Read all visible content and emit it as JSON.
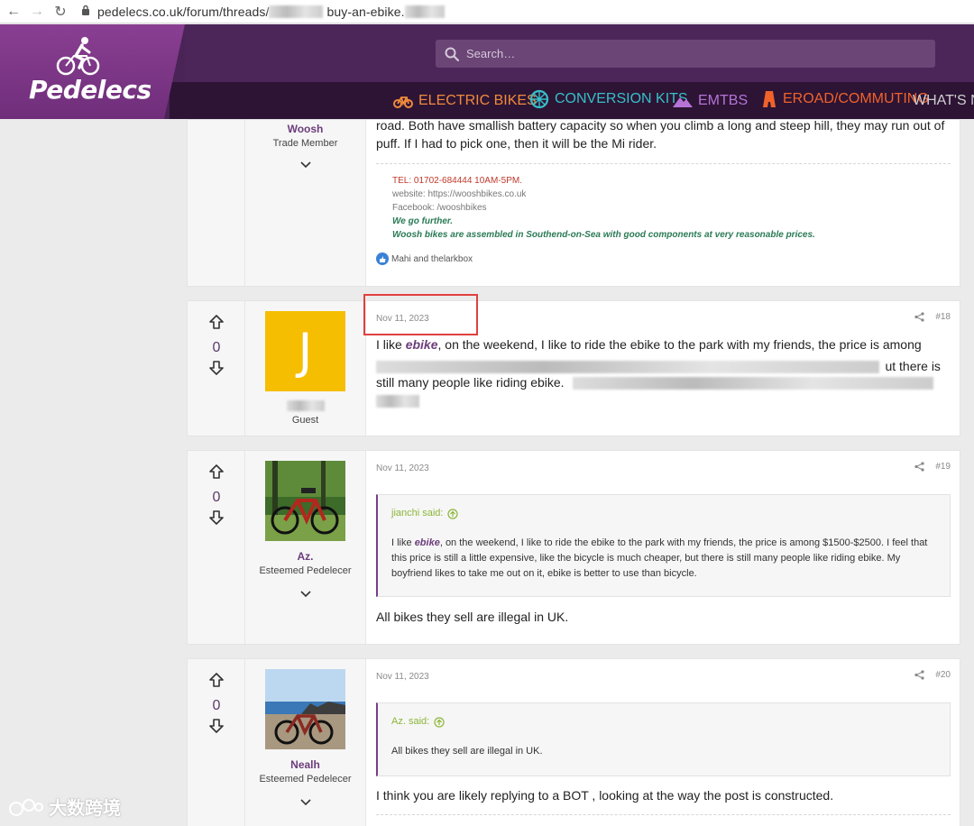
{
  "browser": {
    "url_prefix": "pedelecs.co.uk/forum/threads/",
    "url_suffix": "buy-an-ebike."
  },
  "header": {
    "logo_text": "Pedelecs",
    "search_placeholder": "Search…",
    "nav": [
      {
        "label": "ELECTRIC BIKES",
        "color": "#f08a3c"
      },
      {
        "label": "CONVERSION KITS",
        "color": "#36c0c7"
      },
      {
        "label": "EMTBS",
        "color": "#b674d6"
      },
      {
        "label": "EROAD/COMMUTING",
        "color": "#f0622a"
      },
      {
        "label": "WHAT'S NEW",
        "color": "#cfcfcf"
      }
    ]
  },
  "posts": [
    {
      "username": "Woosh",
      "user_title": "Trade Member",
      "body_line1": "road. Both have smallish battery capacity so when you climb a long and steep hill, they may run out of",
      "body_line2": "puff. If I had to pick one, then it will be the Mi rider.",
      "sig": {
        "tel": "TEL: 01702-684444 10AM-5PM.",
        "website": "website: https://wooshbikes.co.uk",
        "facebook": "Facebook: /wooshbikes",
        "tagline1": "We go further.",
        "tagline2": "Woosh bikes are assembled in Southend-on-Sea with good components at very reasonable prices."
      },
      "reactions": "Mahi and thelarkbox"
    },
    {
      "vote_count": "0",
      "avatar_letter": "J",
      "user_title": "Guest",
      "date": "Nov 11, 2023",
      "post_number": "#18",
      "body_pre": "I like ",
      "body_em": "ebike",
      "body_post": ", on the weekend, I like to ride the ebike to the park with my friends, the price is among",
      "body_frag_2": "ut there is",
      "body_line3": "still many people like riding ebike."
    },
    {
      "vote_count": "0",
      "username": "Az.",
      "user_title": "Esteemed Pedelecer",
      "date": "Nov 11, 2023",
      "post_number": "#19",
      "quote_author": "jianchi said:",
      "quote_pre": "I like ",
      "quote_em": "ebike",
      "quote_post": ", on the weekend, I like to ride the ebike to the park with my friends, the price is among $1500-$2500. I feel that this price is still a little expensive, like the bicycle is much cheaper, but there is still many people like riding ebike. My boyfriend likes to take me out on it, ebike is better to use than bicycle.",
      "body": "All bikes they sell are illegal in UK."
    },
    {
      "vote_count": "0",
      "username": "Nealh",
      "user_title": "Esteemed Pedelecer",
      "date": "Nov 11, 2023",
      "post_number": "#20",
      "quote_author": "Az. said:",
      "quote_body": "All bikes they sell are illegal in UK.",
      "body": "I think you are likely replying to a BOT , looking at the way the post is constructed."
    }
  ],
  "watermark": "大数跨境"
}
